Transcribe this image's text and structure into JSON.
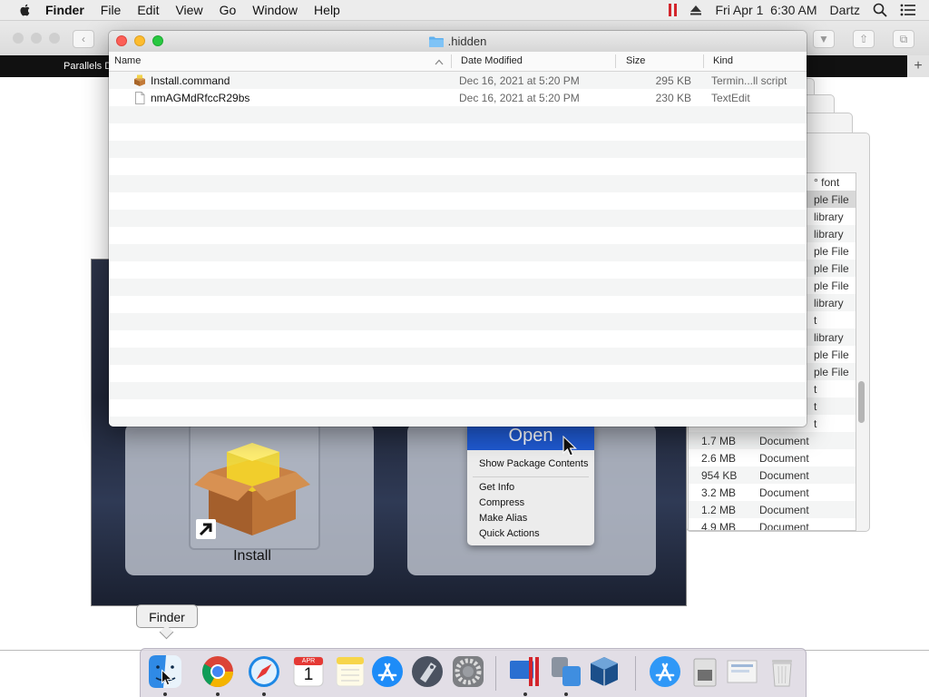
{
  "menubar": {
    "apple": "apple-logo",
    "app_name": "Finder",
    "items": [
      "File",
      "Edit",
      "View",
      "Go",
      "Window",
      "Help"
    ],
    "clock": "Fri Apr 1  6:30 AM",
    "user": "Dartz",
    "icons": [
      "parallels-icon",
      "eject-icon",
      "search-icon",
      "list-icon"
    ]
  },
  "browser": {
    "tab_label": "Parallels D",
    "new_tab": "+"
  },
  "finder": {
    "title": ".hidden",
    "columns": {
      "name": "Name",
      "date": "Date Modified",
      "size": "Size",
      "kind": "Kind"
    },
    "files": [
      {
        "name": "Install.command",
        "date": "Dec 16, 2021 at 5:20 PM",
        "size": "295 KB",
        "kind": "Termin...ll script",
        "icon": "terminal-script-icon"
      },
      {
        "name": "nmAGMdRfccR29bs",
        "date": "Dec 16, 2021 at 5:20 PM",
        "size": "230 KB",
        "kind": "TextEdit",
        "icon": "text-document-icon"
      }
    ]
  },
  "info_list": {
    "rows": [
      {
        "size": "",
        "kind": "font",
        "suffix": "° font"
      },
      {
        "size": "",
        "kind": "ple File"
      },
      {
        "size": "",
        "kind": "library"
      },
      {
        "size": "",
        "kind": "library"
      },
      {
        "size": "",
        "kind": "ple File"
      },
      {
        "size": "",
        "kind": "ple File"
      },
      {
        "size": "",
        "kind": "ple File"
      },
      {
        "size": "",
        "kind": "library"
      },
      {
        "size": "",
        "kind": "t"
      },
      {
        "size": "",
        "kind": "library"
      },
      {
        "size": "",
        "kind": "ple File"
      },
      {
        "size": "",
        "kind": "ple File"
      },
      {
        "size": "",
        "kind": "t"
      },
      {
        "size": "",
        "kind": "t"
      },
      {
        "size": "",
        "kind": "t"
      },
      {
        "size": "1.7 MB",
        "kind": "Document"
      },
      {
        "size": "2.6 MB",
        "kind": "Document"
      },
      {
        "size": "954 KB",
        "kind": "Document"
      },
      {
        "size": "3.2 MB",
        "kind": "Document"
      },
      {
        "size": "1.2 MB",
        "kind": "Document"
      },
      {
        "size": "4.9 MB",
        "kind": "Document"
      }
    ]
  },
  "dmg": {
    "install_label": "Install"
  },
  "context_menu": {
    "open": "Open",
    "items": [
      "Show Package Contents",
      "Get Info",
      "Compress",
      "Make Alias",
      "Quick Actions"
    ]
  },
  "dock": {
    "tooltip": "Finder",
    "apps": [
      "finder-icon",
      "chrome-icon",
      "safari-icon",
      "calendar-icon",
      "notes-icon",
      "app-store-icon",
      "launchpad-icon",
      "system-preferences-icon",
      "parallels-icon",
      "migration-assistant-icon",
      "virtualbox-icon",
      "app-store-downloads-icon",
      "installer-disk-icon",
      "preview-doc-icon",
      "trash-icon"
    ],
    "calendar_month": "APR",
    "calendar_day": "1"
  }
}
